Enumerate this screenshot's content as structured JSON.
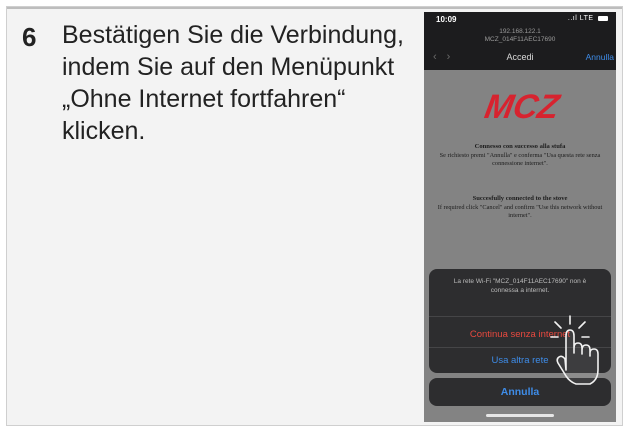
{
  "step": {
    "number": "6",
    "lines": [
      "Bestätigen Sie die Verbindung,",
      "indem Sie auf den Menüpunkt",
      "„Ohne Internet fortfahren“",
      "klicken."
    ]
  },
  "phone": {
    "status": {
      "time": "10:09",
      "signal": "..ıl LTE"
    },
    "header": {
      "ip": "192.168.122.1",
      "ssid": "MCZ_014F11AEC17690",
      "title": "Accedi",
      "cancel": "Annulla"
    },
    "logo": "MCZ",
    "logo_color": "#d7232f",
    "message_it": {
      "title": "Connesso con successo alla stufa",
      "body": "Se richiesto premi \"Annulla\" e conferma \"Usa questa rete senza connessione internet\"."
    },
    "message_en": {
      "title": "Succesfully connected to the stove",
      "body": "If required click \"Cancel\" and confirm \"Use this network without internet\"."
    },
    "sheet": {
      "message": "La rete Wi-Fi \"MCZ_014F11AEC17690\" non è connessa a internet.",
      "continue": "Continua senza internet",
      "other": "Usa altra rete",
      "cancel": "Annulla"
    },
    "colors": {
      "destructive": "#e8493f",
      "link": "#3e8ce8"
    },
    "icons": [
      "back-arrow-icon",
      "forward-arrow-icon",
      "battery-icon",
      "tap-hand-icon"
    ]
  }
}
